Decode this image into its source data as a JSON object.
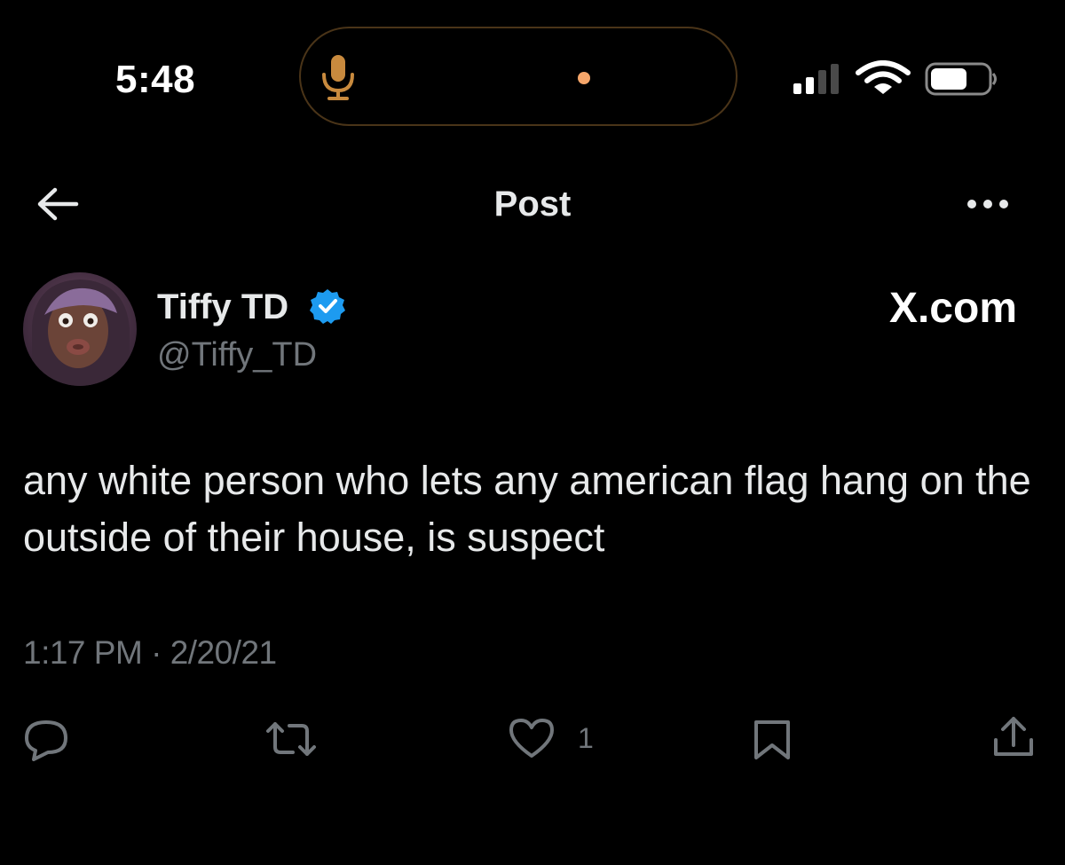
{
  "status_bar": {
    "time": "5:48",
    "icons": [
      "microphone-icon",
      "signal-icon",
      "wifi-icon",
      "battery-icon"
    ]
  },
  "nav": {
    "title": "Post",
    "back_icon": "arrow-left-icon",
    "more_icon": "more-icon"
  },
  "author": {
    "name": "Tiffy TD",
    "handle": "@Tiffy_TD",
    "verified": true
  },
  "brand": {
    "label": "X.com"
  },
  "post": {
    "text": "any white person who lets any american flag hang on the outside of their house, is suspect",
    "time": "1:17 PM",
    "separator": "·",
    "date": "2/20/21"
  },
  "actions": {
    "like_count": "1",
    "icons": [
      "reply-icon",
      "repost-icon",
      "like-icon",
      "bookmark-icon",
      "share-icon"
    ]
  },
  "colors": {
    "background": "#000000",
    "text_primary": "#e7e9ea",
    "text_secondary": "#71767b",
    "verified": "#1d9bf0",
    "island_border": "#4a3418",
    "mic": "#c88a3e",
    "island_dot": "#f6a66a"
  }
}
